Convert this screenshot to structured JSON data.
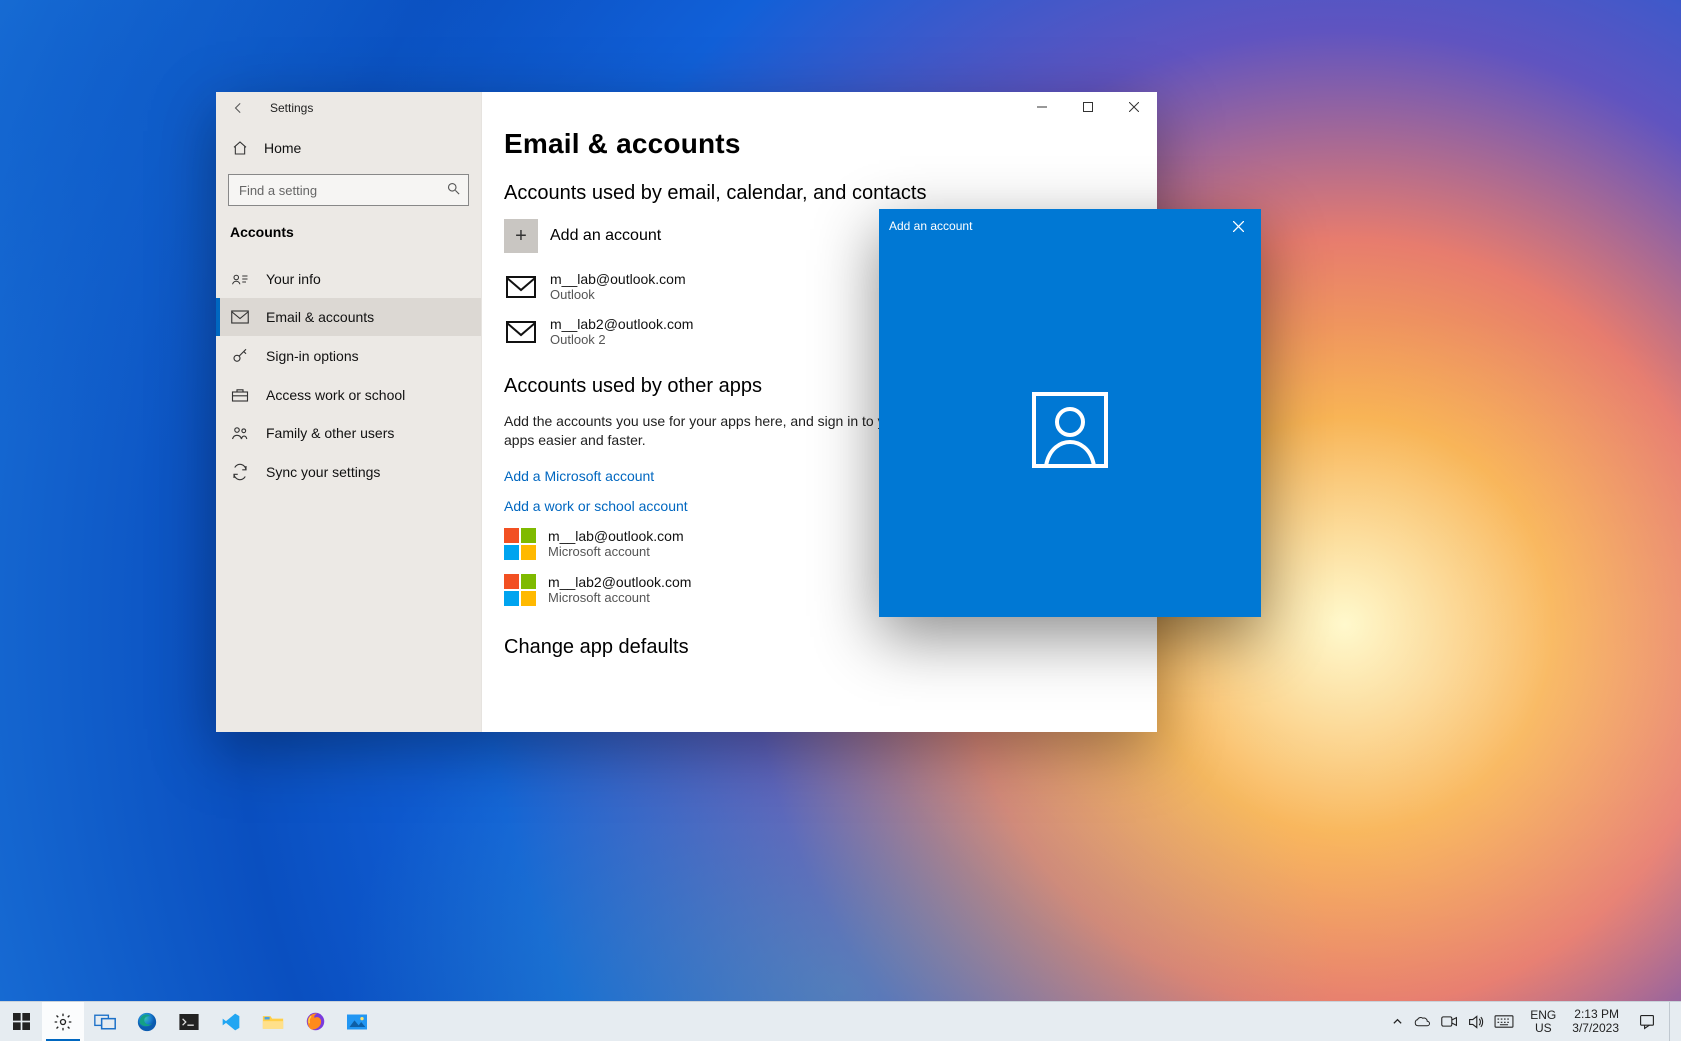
{
  "window": {
    "title": "Settings",
    "home_label": "Home",
    "search_placeholder": "Find a setting",
    "category": "Accounts",
    "side_items": [
      {
        "id": "your-info",
        "label": "Your info"
      },
      {
        "id": "email-accounts",
        "label": "Email & accounts"
      },
      {
        "id": "sign-in",
        "label": "Sign-in options"
      },
      {
        "id": "work-school",
        "label": "Access work or school"
      },
      {
        "id": "family",
        "label": "Family & other users"
      },
      {
        "id": "sync",
        "label": "Sync your settings"
      }
    ],
    "active_side_item": "email-accounts"
  },
  "page": {
    "title": "Email & accounts",
    "section_accounts_email": "Accounts used by email, calendar, and contacts",
    "add_account_label": "Add an account",
    "email_accounts": [
      {
        "address": "m__lab@outlook.com",
        "provider": "Outlook"
      },
      {
        "address": "m__lab2@outlook.com",
        "provider": "Outlook 2"
      }
    ],
    "section_other_apps": "Accounts used by other apps",
    "other_apps_desc": "Add the accounts you use for your apps here, and sign in to your favorite apps easier and faster.",
    "link_add_ms": "Add a Microsoft account",
    "link_add_work": "Add a work or school account",
    "ms_accounts": [
      {
        "address": "m__lab@outlook.com",
        "type": "Microsoft account"
      },
      {
        "address": "m__lab2@outlook.com",
        "type": "Microsoft account"
      }
    ],
    "section_change_defaults": "Change app defaults"
  },
  "dialog": {
    "title": "Add an account"
  },
  "taskbar": {
    "lang_top": "ENG",
    "lang_bottom": "US",
    "time": "2:13 PM",
    "date": "3/7/2023"
  }
}
